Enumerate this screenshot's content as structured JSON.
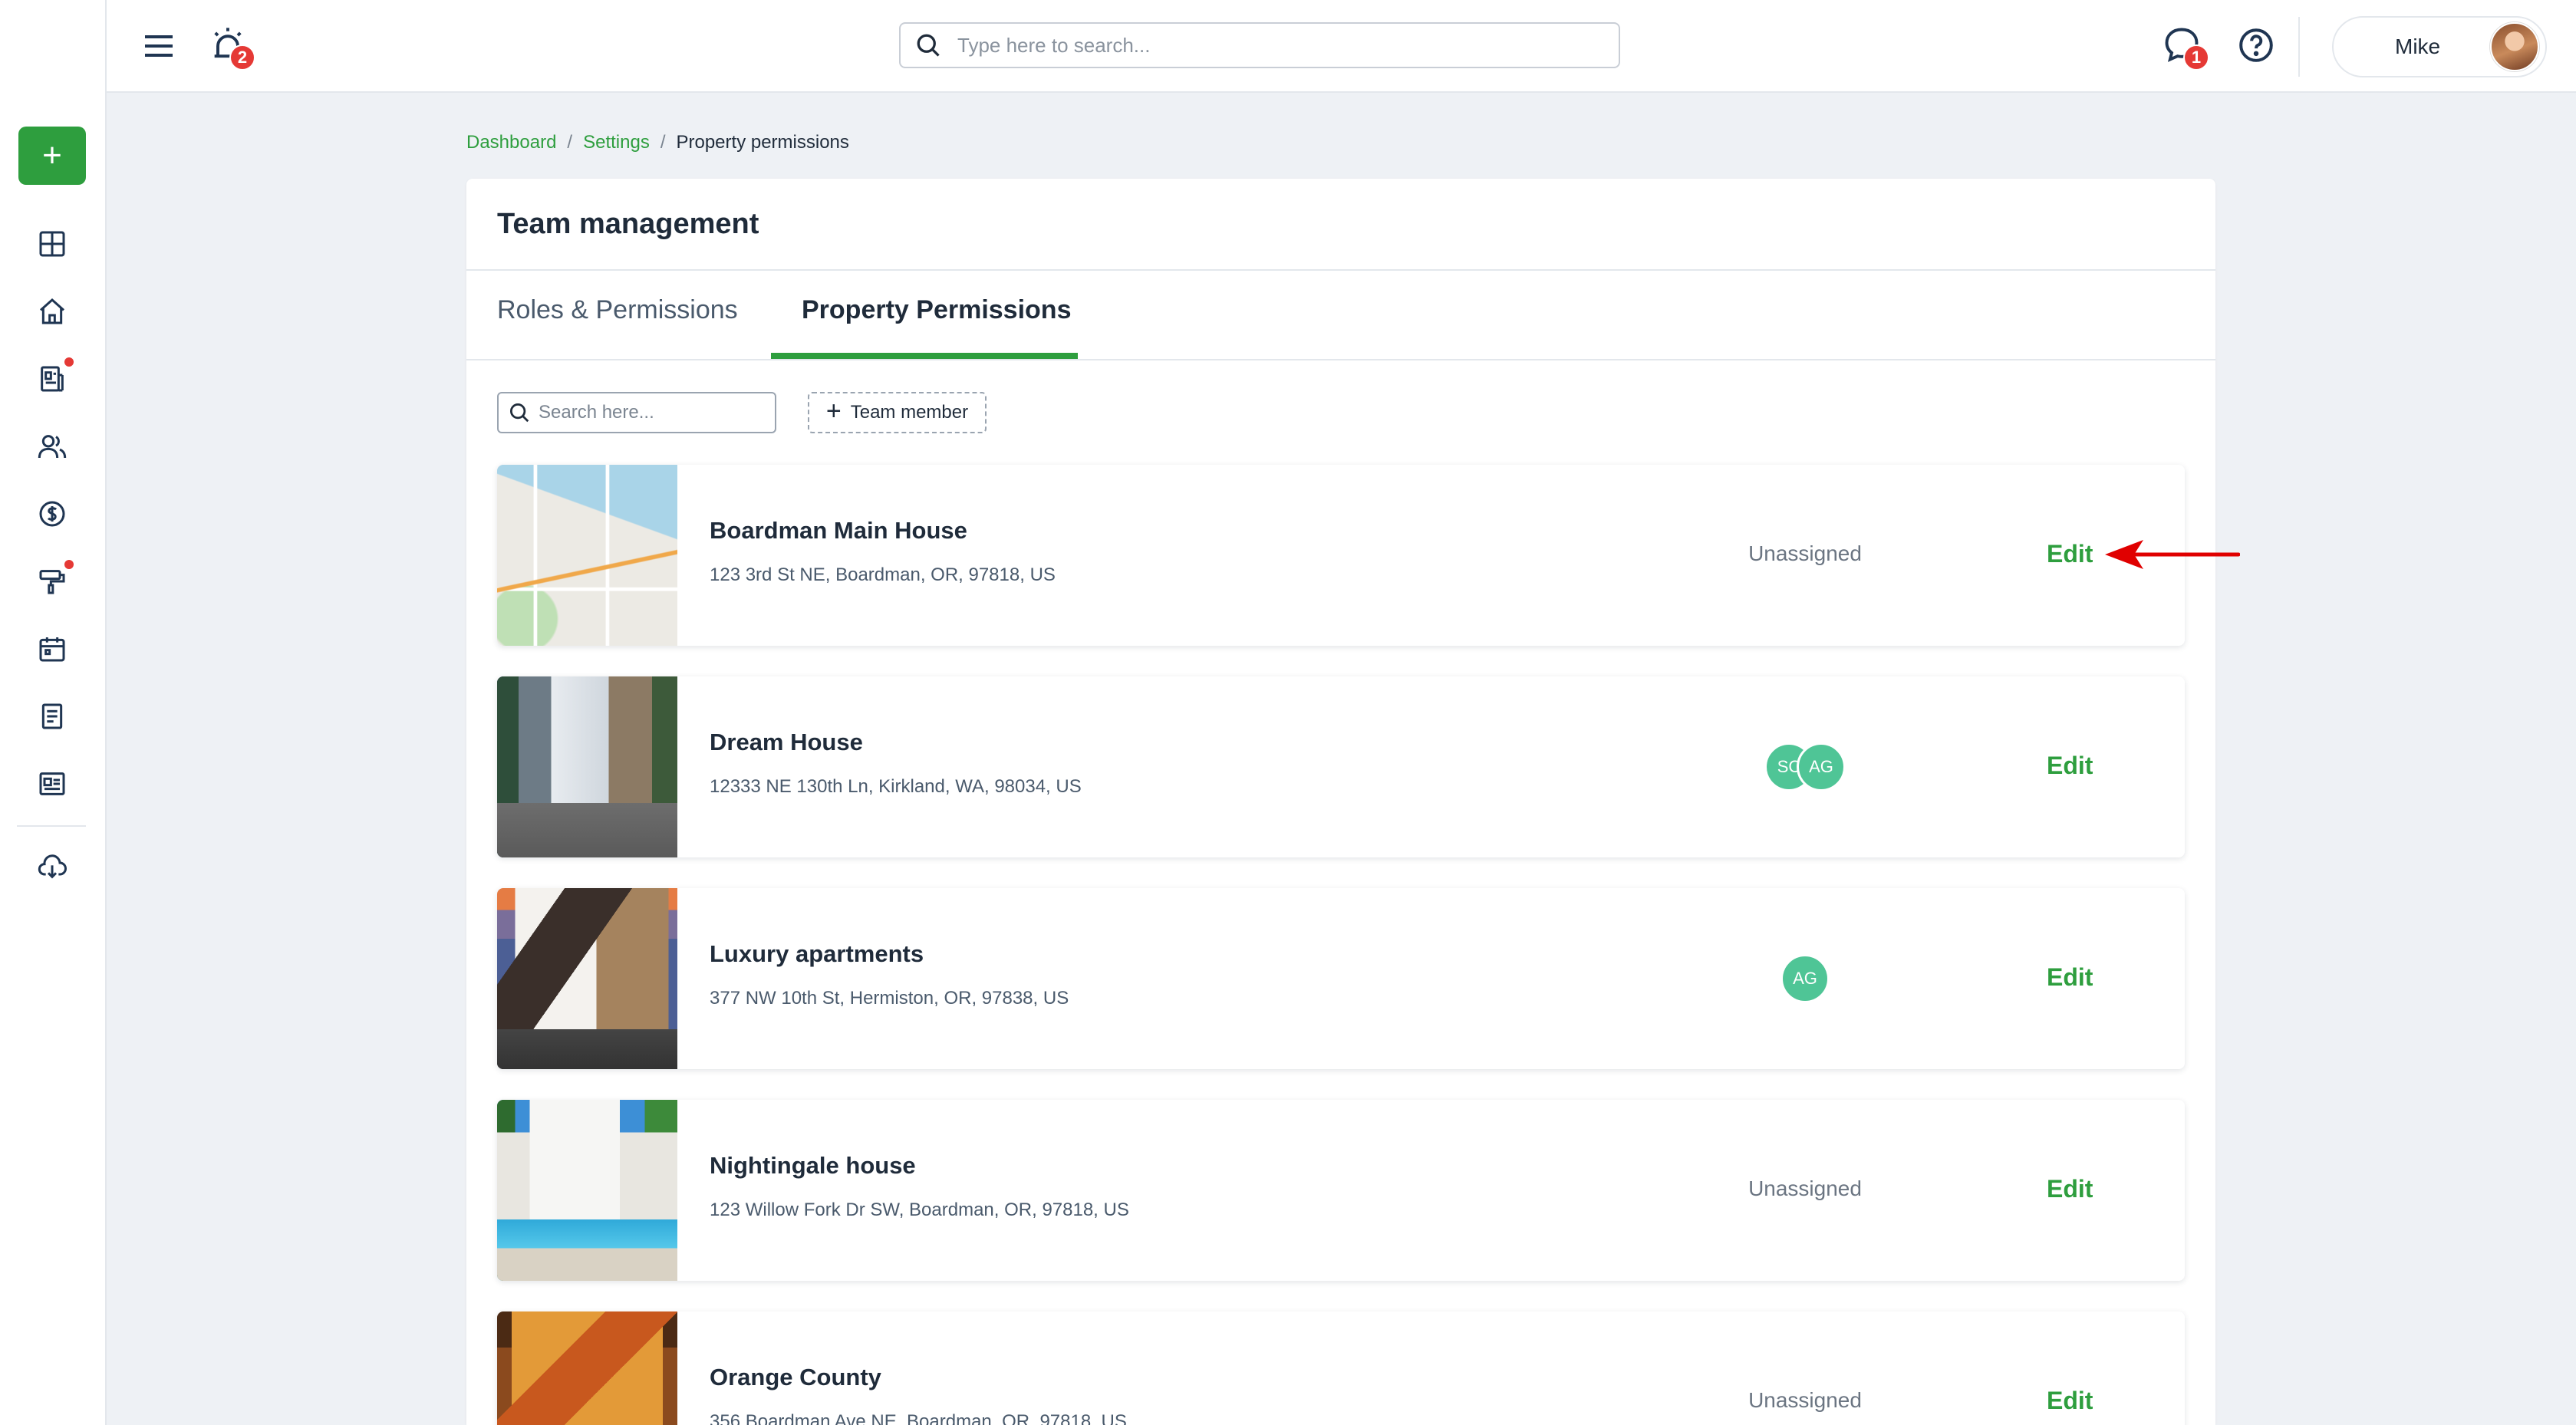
{
  "topbar": {
    "alarm_badge": "2",
    "search_placeholder": "Type here to search...",
    "chat_badge": "1",
    "user_name": "Mike"
  },
  "sidebar": {
    "add_label": "+",
    "items": [
      {
        "icon": "dashboard-icon"
      },
      {
        "icon": "home-icon"
      },
      {
        "icon": "reports-icon",
        "dot": true
      },
      {
        "icon": "people-icon"
      },
      {
        "icon": "dollar-icon"
      },
      {
        "icon": "maintenance-icon",
        "dot": true
      },
      {
        "icon": "calendar-icon"
      },
      {
        "icon": "document-icon"
      },
      {
        "icon": "listing-icon"
      },
      {
        "icon": "download-icon"
      }
    ]
  },
  "breadcrumb": {
    "items": [
      "Dashboard",
      "Settings"
    ],
    "separator": "/",
    "current": "Property permissions"
  },
  "card": {
    "title": "Team management",
    "tabs": [
      {
        "label": "Roles & Permissions",
        "active": false
      },
      {
        "label": "Property Permissions",
        "active": true
      }
    ],
    "search_placeholder": "Search here...",
    "team_button_label": "Team member"
  },
  "properties": [
    {
      "name": "Boardman Main House",
      "address": "123 3rd St NE, Boardman, OR, 97818, US",
      "assigned": "Unassigned",
      "members": [],
      "edit_label": "Edit",
      "thumb": "map"
    },
    {
      "name": "Dream House",
      "address": "12333 NE 130th Ln, Kirkland, WA, 98034, US",
      "assigned": "",
      "members": [
        "SC",
        "AG"
      ],
      "edit_label": "Edit",
      "thumb": "house1"
    },
    {
      "name": "Luxury apartments",
      "address": "377 NW 10th St, Hermiston, OR, 97838, US",
      "assigned": "",
      "members": [
        "AG"
      ],
      "edit_label": "Edit",
      "thumb": "house2"
    },
    {
      "name": "Nightingale house",
      "address": "123 Willow Fork Dr SW, Boardman, OR, 97818, US",
      "assigned": "Unassigned",
      "members": [],
      "edit_label": "Edit",
      "thumb": "house3"
    },
    {
      "name": "Orange County",
      "address": "356 Boardman Ave NE, Boardman, OR, 97818, US",
      "assigned": "Unassigned",
      "members": [],
      "edit_label": "Edit",
      "thumb": "house4"
    }
  ],
  "colors": {
    "accent": "#2e9e3e",
    "badge": "#e53935",
    "member_chip": "#4fc596",
    "annotation_arrow": "#e00000"
  }
}
